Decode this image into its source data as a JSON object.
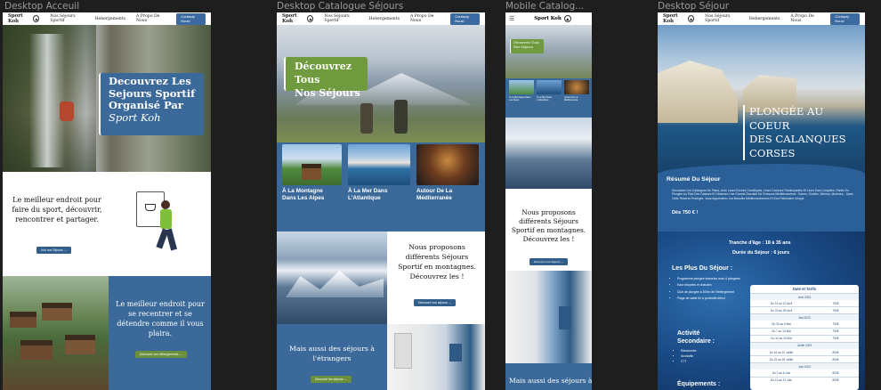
{
  "frames": {
    "accueil_label": "Desktop Acceuil",
    "catalogue_label": "Desktop Catalogue Séjours",
    "mobile_label": "Mobile Catalog...",
    "sejour_label": "Desktop Séjour"
  },
  "nav": {
    "brand": "Sport Koh",
    "logo_glyph": "⛰",
    "links": [
      "Nos Séjours Sportif",
      "Hebergements",
      "À Propo De Nous"
    ],
    "cta": "Contacty Nous!",
    "cta_sejour": "Contacty Nous!"
  },
  "accueil": {
    "hero_title_1": "Decouvrez Les",
    "hero_title_2": "Sejours Sportif",
    "hero_title_3": "Organisé Par",
    "hero_title_4": "Sport Koh",
    "section1_text": "Le meilleur endroit pour faire du sport, découvrir, rencontrer et partager.",
    "section1_button": "Voir nos Séjours →",
    "section2_text": "Le meilleur endroit pour se recentrer et se détendre comme il vous plaira.",
    "section2_button": "Découvrir nos hébergements →"
  },
  "catalogue": {
    "hero_title_1": "Découvrez Tous",
    "hero_title_2": "Nos Séjours",
    "card1": "À La Montagne Dans Les Alpes",
    "card2": "À La Mer Dans L'Atlantique",
    "card3": "Autour De La Méditerranée",
    "promo_text": "Nous proposons différents Séjours Sportif en montagnes. Découvrez les !",
    "promo_button": "Découvrir nos séjours →",
    "abroad_text": "Mais aussi des séjours à l'étrangers",
    "abroad_button": "Découvrir les séjours →"
  },
  "mobile": {
    "hero_title": "Découvrez Tous Nos Séjours",
    "card1": "À La Montagne Dans Les Alpes",
    "card2": "À La Mer Dans L'Atlantique",
    "card3": "Autour De La Méditerranée",
    "promo_text": "Nous proposons différents Séjours Sportif en montagnes. Découvrez les !",
    "promo_button": "Découvrir nos Séjours →",
    "abroad_text": "Mais aussi des séjours à l'"
  },
  "sejour": {
    "hero_title_1": "PLONGÉE AU COEUR",
    "hero_title_2": "DES CALANQUES",
    "hero_title_3": "CORSES",
    "resume_title": "Résumé Du Séjour",
    "resume_text": "Découvrez Les Calanques De Piana, Avec Leurs Roches Granitiques, Leurs Couleurs Flamboyantes Et Leurs Eaux Limpides. Partez En Plongée Au Pied Des Falaises Et Observez Une Grande Diversité De Poissons Méditerranéens : Sarres, Girelles, Mérous, Murènes... Dans Cette Réserve Protégée, Vous Apprécierez Les Beautés Méditerranéennes Et Son Patrimoine Unique",
    "price": "Dès 750 € !",
    "age": "Tranche d'âge : 18 à 35 ans",
    "duration": "Durée du Séjour : 6 jours",
    "plus_title": "Les Plus Du Séjour :",
    "plus_items": [
      "Programme plongée intensive avec 6 plongées",
      "Eaux limpides et chaudes",
      "Club de plongée à 200m de l'hébergement",
      "Plage de sable fin à proximité direct"
    ],
    "activity_title": "Activité Secondaire :",
    "activity_items": [
      "Randonnée",
      "Snorkelin",
      "VTT"
    ],
    "equip_title": "Équipements :",
    "table_title": "Date et Tarifs",
    "months": [
      "Avril 2023",
      "Mai 2023",
      "Juillet 2023",
      "Juin 2023"
    ],
    "rows": [
      [
        "Du 16 au 22 Avril",
        "750€"
      ],
      [
        "Du 23 au 29 Avril",
        "750€"
      ],
      [
        "Du 30 au 6 Mai",
        "750€"
      ],
      [
        "Du 7 au 13 Mai",
        "750€"
      ],
      [
        "Du 14 au 20 Mai",
        "750€"
      ],
      [
        "Du 16 au 22 Juillet",
        "800€"
      ],
      [
        "Du 23 au 29 Juillet",
        "800€"
      ],
      [
        "Du 2 au 6 Juin",
        "800€"
      ],
      [
        "Du 13 au 19 Juin",
        "800€"
      ]
    ]
  }
}
